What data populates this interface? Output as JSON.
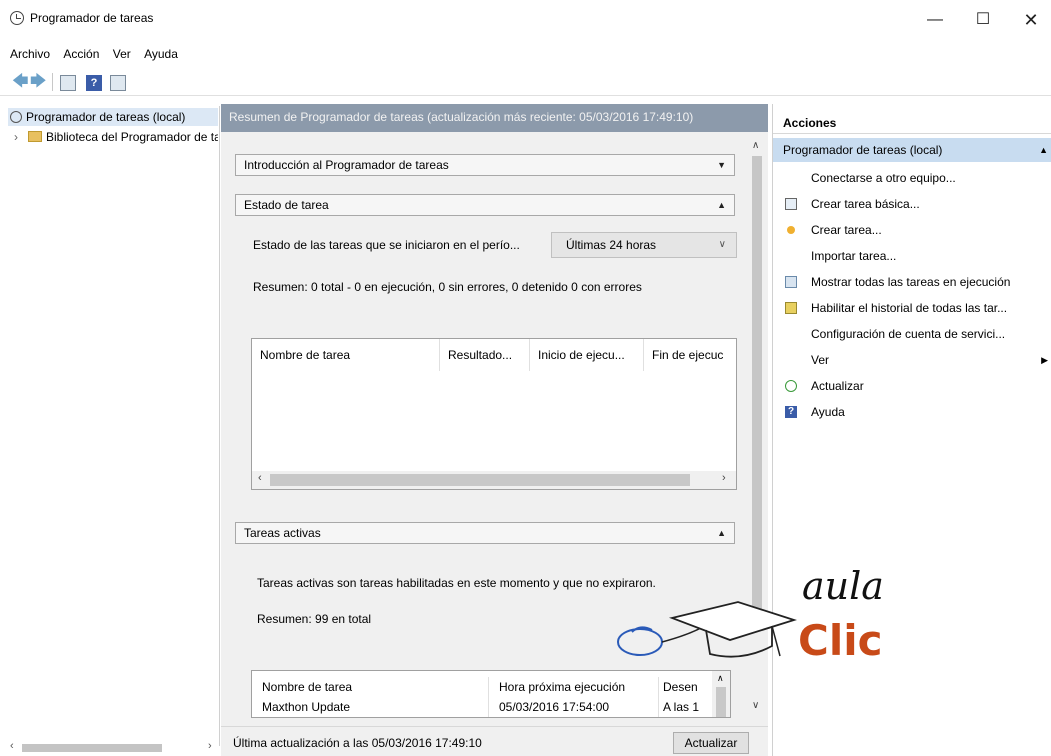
{
  "window": {
    "title": "Programador de tareas"
  },
  "menu": [
    "Archivo",
    "Acción",
    "Ver",
    "Ayuda"
  ],
  "tree": {
    "root": "Programador de tareas (local)",
    "child": "Biblioteca del Programador de tareas"
  },
  "center": {
    "header": "Resumen de Programador de tareas (actualización más reciente: 05/03/2016 17:49:10)",
    "section_intro": "Introducción al Programador de tareas",
    "section_estado": "Estado de tarea",
    "estado_label": "Estado de las tareas que se iniciaron en el perío...",
    "estado_dropdown": "Últimas 24 horas",
    "resumen_estado": "Resumen: 0 total - 0 en ejecución, 0 sin errores, 0 detenido 0 con errores",
    "grid1_columns": [
      "Nombre de tarea",
      "Resultado...",
      "Inicio de ejecu...",
      "Fin de ejecuc"
    ],
    "section_activas": "Tareas activas",
    "activas_text": "Tareas activas son tareas habilitadas en este momento y que no expiraron.",
    "resumen_activas": "Resumen: 99 en total",
    "grid2_columns": [
      "Nombre de tarea",
      "Hora próxima ejecución",
      "Desen"
    ],
    "grid2_rows": [
      [
        "Maxthon Update",
        "05/03/2016 17:54:00",
        "A las 1"
      ]
    ],
    "footer_text": "Última actualización a las 05/03/2016 17:49:10",
    "footer_button": "Actualizar"
  },
  "actions": {
    "header": "Acciones",
    "group": "Programador de tareas (local)",
    "items": [
      {
        "label": "Conectarse a otro equipo...",
        "icon": "none"
      },
      {
        "label": "Crear tarea básica...",
        "icon": "basic-task-icon"
      },
      {
        "label": "Crear tarea...",
        "icon": "create-task-icon"
      },
      {
        "label": "Importar tarea...",
        "icon": "none"
      },
      {
        "label": "Mostrar todas las tareas en ejecución",
        "icon": "running-tasks-icon"
      },
      {
        "label": "Habilitar el historial de todas las tar...",
        "icon": "history-icon"
      },
      {
        "label": "Configuración de cuenta de servici...",
        "icon": "none"
      },
      {
        "label": "Ver",
        "icon": "none"
      },
      {
        "label": "Actualizar",
        "icon": "refresh-icon"
      },
      {
        "label": "Ayuda",
        "icon": "help-icon"
      }
    ]
  },
  "watermark": {
    "line1": "aula",
    "line2": "Clic"
  },
  "colors": {
    "center_header": "#8c9aab",
    "selected_group": "#c8dcf0",
    "logo_accent": "#c84a18"
  }
}
